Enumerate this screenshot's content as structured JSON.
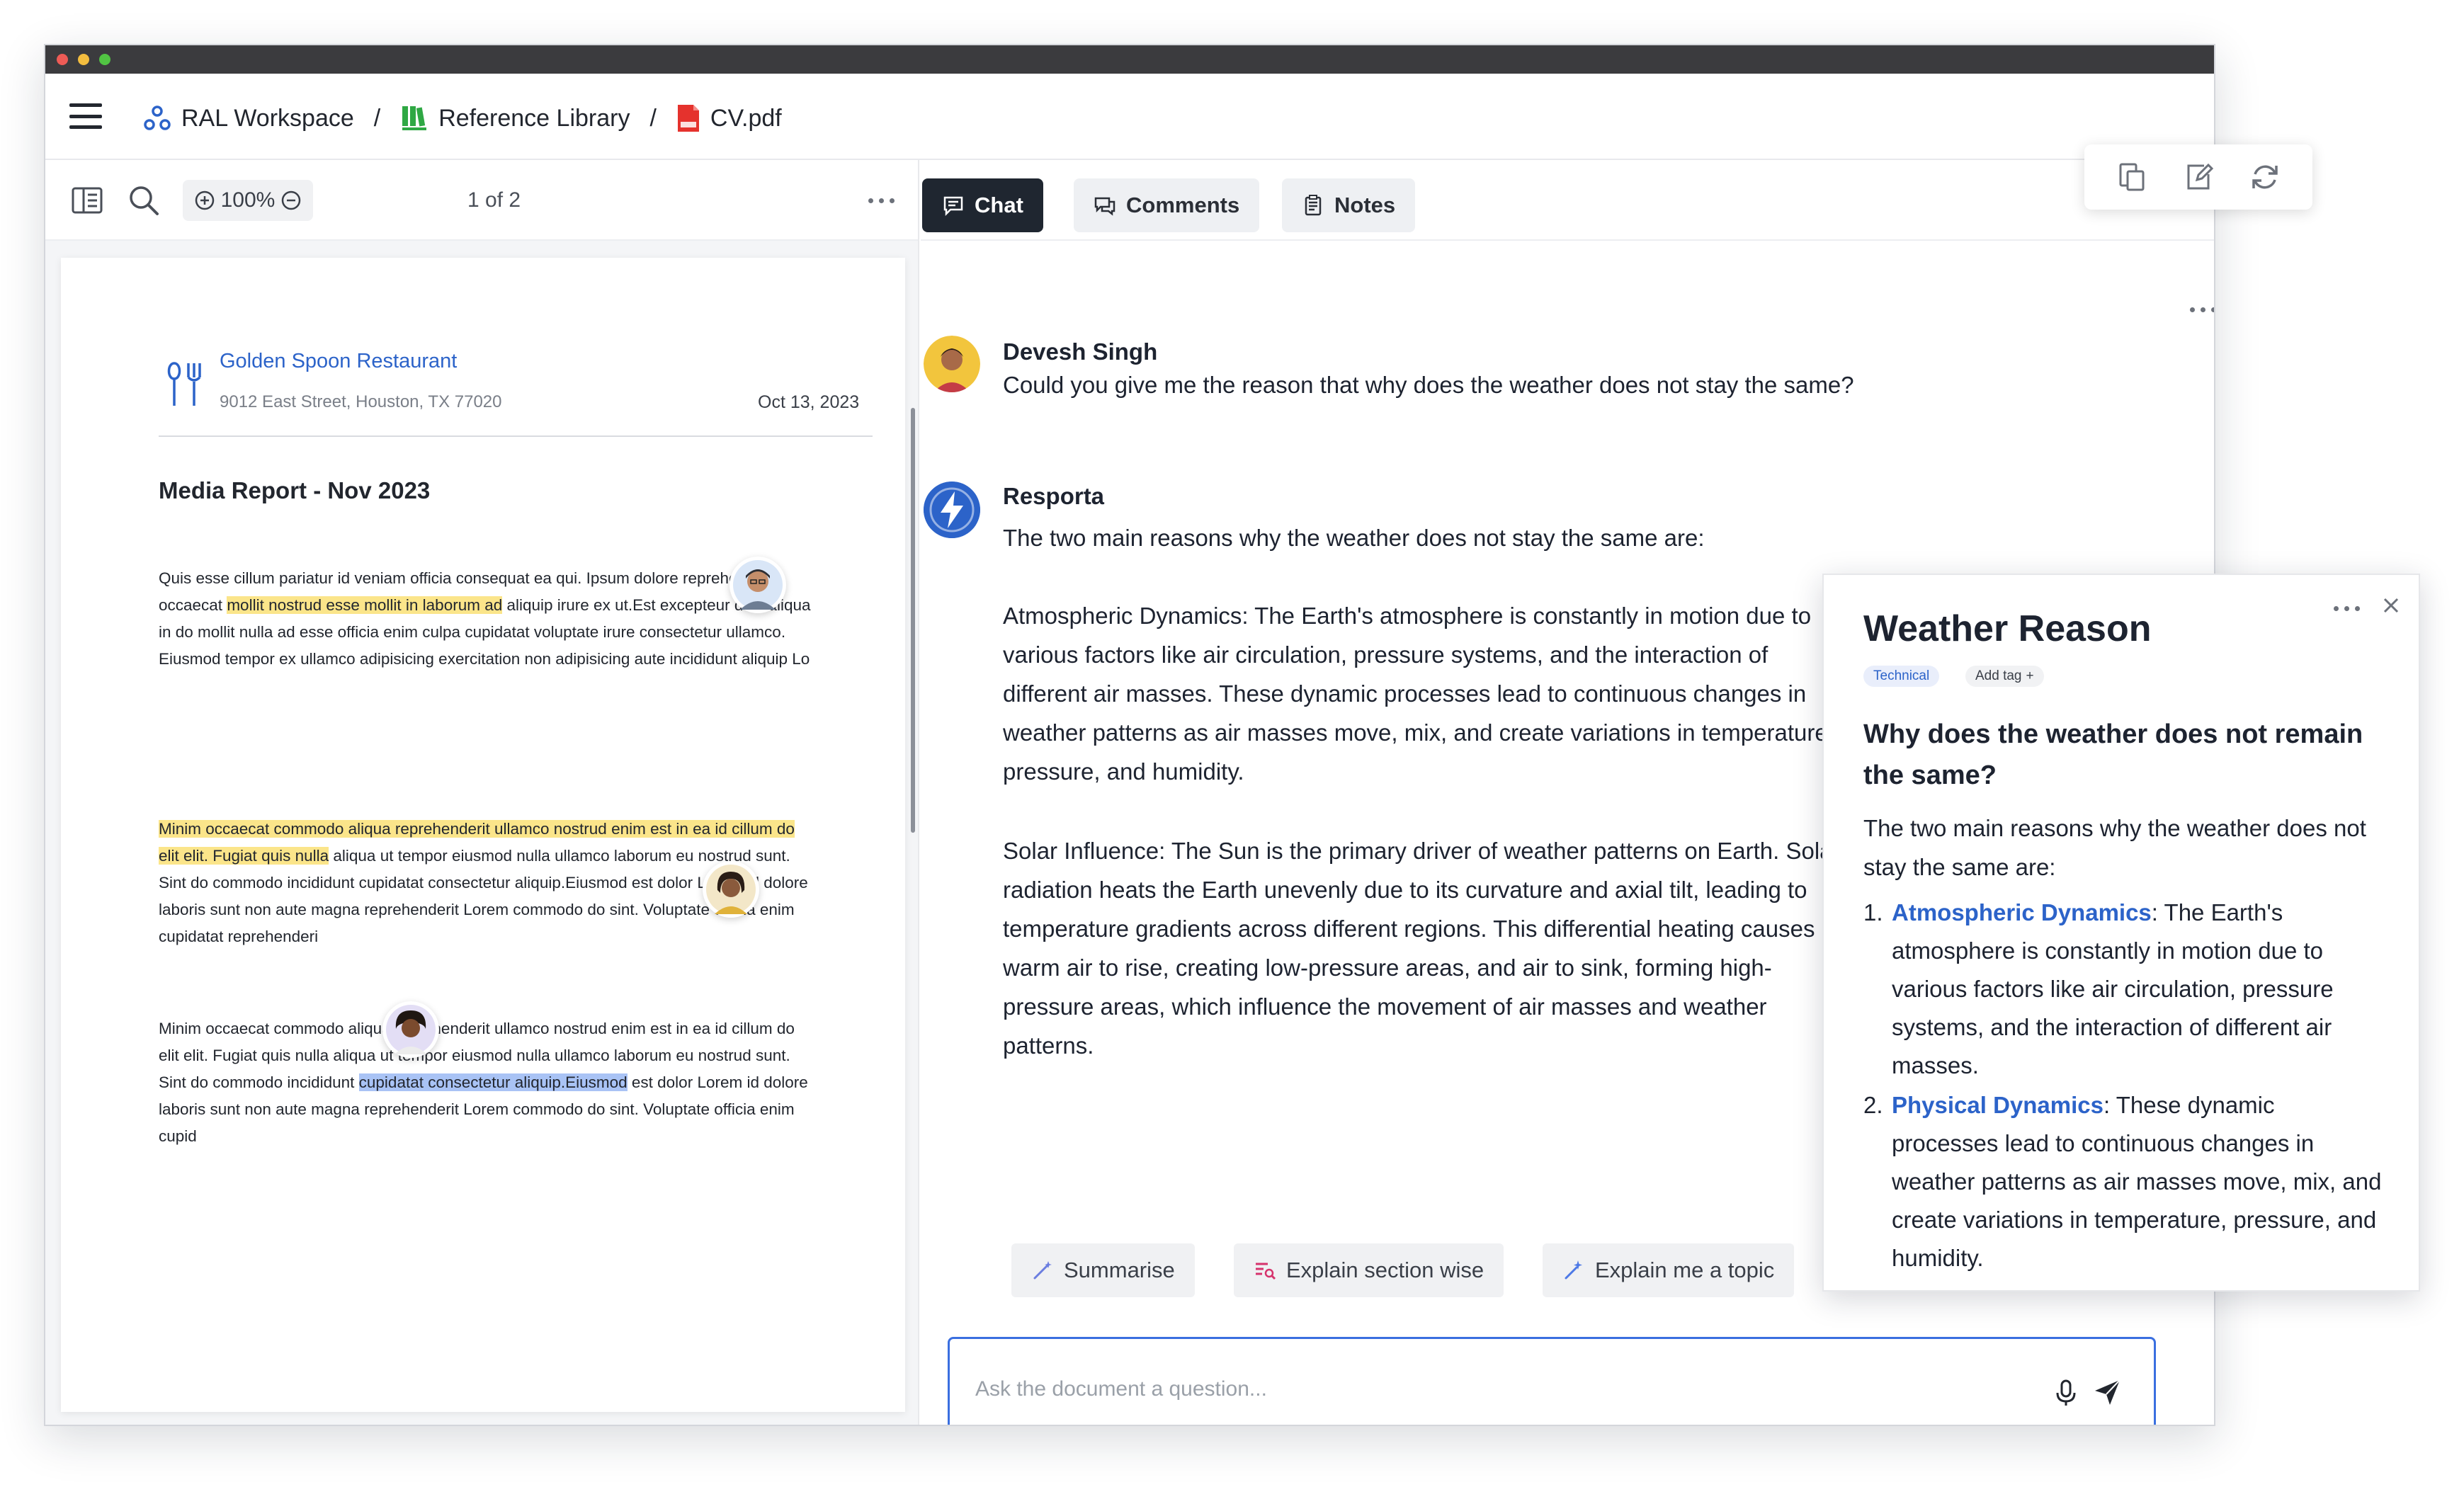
{
  "breadcrumb": {
    "workspace": "RAL Workspace",
    "library": "Reference Library",
    "file": "CV.pdf",
    "separator": "/"
  },
  "viewer": {
    "zoom": "100%",
    "pages": "1 of 2"
  },
  "document": {
    "restaurant": "Golden Spoon Restaurant",
    "address": "9012 East Street, Houston, TX 77020",
    "date": "Oct 13, 2023",
    "title": "Media Report - Nov 2023",
    "para1_pre": "Quis esse cillum pariatur id veniam officia consequat ea qui. Ipsum dolore reprehenderit occaecat ",
    "para1_hl": "mollit nostrud esse mollit in laborum ad",
    "para1_post": " aliquip irure ex ut.Est excepteur duis aliqua in do mollit nulla ad esse officia enim culpa cupidatat voluptate irure consectetur ullamco. Eiusmod tempor ex ullamco adipisicing exercitation non adipisicing aute incididunt aliquip Lo",
    "para2_hl": "Minim occaecat commodo aliqua reprehenderit ullamco nostrud enim est in ea id cillum do elit elit. Fugiat quis nulla",
    "para2_post": " aliqua ut tempor eiusmod nulla ullamco laborum eu nostrud sunt. Sint do commodo incididunt cupidatat consectetur aliquip.Eiusmod est dolor Lorem id dolore laboris sunt non aute magna reprehenderit Lorem commodo do sint. Voluptate officia enim cupidatat reprehenderi",
    "para3_pre": "Minim occaecat commodo aliqua reprehenderit ullamco nostrud enim est in ea id cillum do elit elit. Fugiat quis nulla aliqua ut tempor eiusmod nulla ullamco laborum eu nostrud sunt. Sint do commodo incididunt ",
    "para3_hl": "cupidatat consectetur aliquip.Eiusmod",
    "para3_post": " est dolor Lorem id dolore laboris sunt non aute magna reprehenderit Lorem commodo do sint. Voluptate officia enim cupid"
  },
  "tabs": {
    "chat": "Chat",
    "comments": "Comments",
    "notes": "Notes"
  },
  "chat": {
    "user_name": "Devesh Singh",
    "user_message": "Could you give me the reason that why does the weather does not stay the same?",
    "bot_name": "Resporta",
    "bot_intro": "The two main reasons why the weather does not stay the same are:",
    "bot_p1": "Atmospheric Dynamics: The Earth's atmosphere is constantly in motion due to various factors like air circulation, pressure systems, and the interaction of different air masses. These dynamic processes lead to continuous changes in weather patterns as air masses move, mix, and create variations in temperature, pressure, and humidity.",
    "bot_p2": "Solar Influence: The Sun is the primary driver of weather patterns on Earth. Solar radiation heats the Earth unevenly due to its curvature and axial tilt, leading to temperature gradients across different regions. This differential heating causes warm air to rise, creating low-pressure areas, and air to sink, forming high-pressure areas, which influence the movement of air masses and weather patterns."
  },
  "suggestions": {
    "summarise": "Summarise",
    "explain_section": "Explain section wise",
    "explain_topic": "Explain me a topic"
  },
  "ask": {
    "placeholder": "Ask the document a question..."
  },
  "card": {
    "title": "Weather Reason",
    "tag": "Technical",
    "add_tag": "Add tag",
    "question": "Why does the weather does not remain the same?",
    "intro": "The two main reasons why the weather does not stay the same are:",
    "items": [
      {
        "num": "1.",
        "term": "Atmospheric Dynamics",
        "text": ": The Earth's atmosphere is constantly in motion due to various factors like air circulation, pressure systems, and the interaction of different air masses."
      },
      {
        "num": "2.",
        "term": "Physical Dynamics",
        "text": ": These dynamic processes lead to continuous changes in weather patterns as air masses move, mix, and create variations in temperature, pressure, and humidity."
      }
    ]
  },
  "colors": {
    "accent": "#2c63c9",
    "highlight_yellow": "#fbe58a",
    "highlight_blue": "#a9c3f5",
    "active_tab": "#1f2630"
  }
}
